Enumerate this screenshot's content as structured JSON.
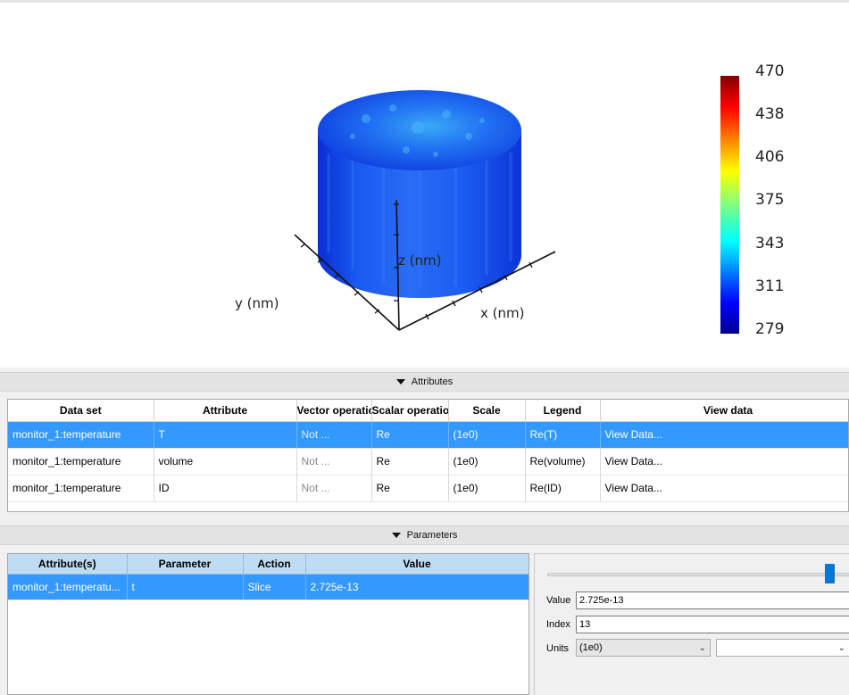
{
  "viewport": {
    "x_axis_label": "x (nm)",
    "y_axis_label": "y (nm)",
    "z_axis_label": "z (nm)",
    "colorbar": {
      "ticks": [
        "470",
        "438",
        "406",
        "375",
        "343",
        "311",
        "279"
      ],
      "colormap": "jet"
    }
  },
  "attributes_section": {
    "title": "Attributes",
    "columns": [
      "Data set",
      "Attribute",
      "Vector operation",
      "Scalar operation",
      "Scale",
      "Legend",
      "View data"
    ],
    "rows": [
      {
        "dataset": "monitor_1:temperature",
        "attribute": "T",
        "vector_op": "Not ...",
        "scalar_op": "Re",
        "scale": "(1e0)",
        "legend": "Re(T)",
        "view": "View Data..."
      },
      {
        "dataset": "monitor_1:temperature",
        "attribute": "volume",
        "vector_op": "Not ...",
        "scalar_op": "Re",
        "scale": "(1e0)",
        "legend": "Re(volume)",
        "view": "View Data..."
      },
      {
        "dataset": "monitor_1:temperature",
        "attribute": "ID",
        "vector_op": "Not ...",
        "scalar_op": "Re",
        "scale": "(1e0)",
        "legend": "Re(ID)",
        "view": "View Data..."
      }
    ]
  },
  "parameters_section": {
    "title": "Parameters",
    "columns": [
      "Attribute(s)",
      "Parameter",
      "Action",
      "Value"
    ],
    "rows": [
      {
        "attributes": "monitor_1:temperatu...",
        "parameter": "t",
        "action": "Slice",
        "value": "2.725e-13"
      }
    ],
    "slider_level": 0.93,
    "value_label": "Value",
    "value": "2.725e-13",
    "index_label": "Index",
    "index": "13",
    "units_label": "Units",
    "units": "(1e0)",
    "units_secondary": ""
  },
  "colors": {
    "selection": "#3399ff",
    "param_header": "#bfdcf4",
    "slider_thumb": "#0078d7"
  }
}
